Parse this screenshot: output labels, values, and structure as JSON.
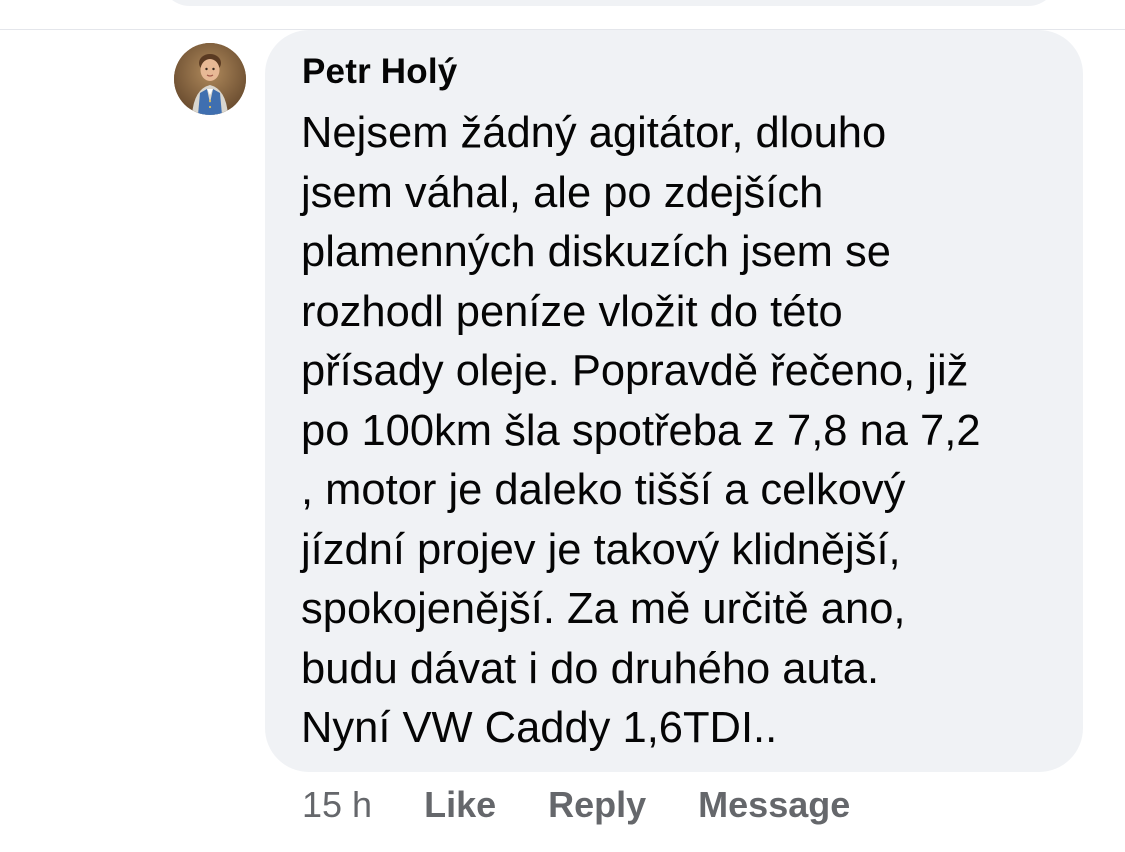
{
  "comment": {
    "author": "Petr Holý",
    "avatar_icon": "profile-photo-avatar",
    "text_lines": [
      "Nejsem žádný agitátor, dlouho",
      "jsem váhal, ale po zdejších",
      "plamenných diskuzích jsem se",
      "rozhodl peníze vložit do této",
      "přísady oleje. Popravdě řečeno, již",
      "po 100km šla spotřeba z 7,8 na 7,2",
      ", motor je daleko tišší a celkový",
      "jízdní projev je takový klidnější,",
      "spokojenější. Za mě určitě ano,",
      "budu dávat i do druhého auta.",
      "Nyní VW Caddy 1,6TDI.."
    ],
    "timestamp": "15 h",
    "actions": {
      "like": "Like",
      "reply": "Reply",
      "message": "Message"
    }
  },
  "colors": {
    "bubble_background": "#f0f2f5",
    "text": "#050505",
    "secondary_text": "#65676b"
  }
}
